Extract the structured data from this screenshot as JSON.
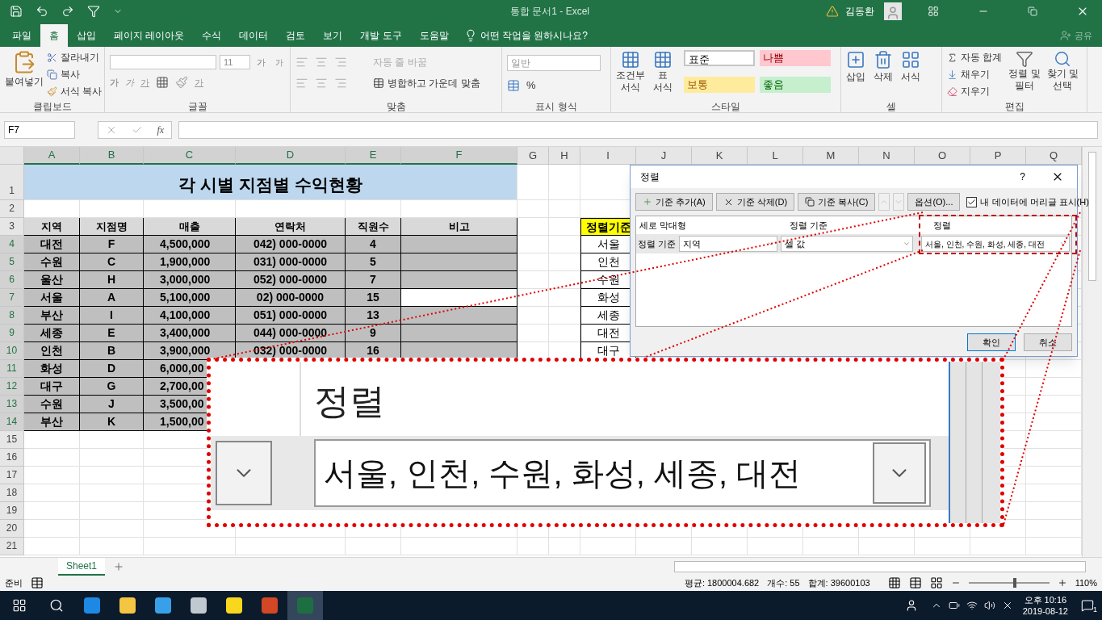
{
  "title_bar": {
    "title": "통합 문서1  -  Excel",
    "user": "김동환"
  },
  "tabs": [
    {
      "label": "파일",
      "selected": false
    },
    {
      "label": "홈",
      "selected": true
    },
    {
      "label": "삽입",
      "selected": false
    },
    {
      "label": "페이지 레이아웃",
      "selected": false
    },
    {
      "label": "수식",
      "selected": false
    },
    {
      "label": "데이터",
      "selected": false
    },
    {
      "label": "검토",
      "selected": false
    },
    {
      "label": "보기",
      "selected": false
    },
    {
      "label": "개발 도구",
      "selected": false
    },
    {
      "label": "도움말",
      "selected": false
    }
  ],
  "tell_me": "어떤 작업을 원하시나요?",
  "share": "공유",
  "clipboard": {
    "label": "클립보드",
    "paste": "붙여넣기",
    "cut": "잘라내기",
    "copy": "복사",
    "format_painter": "서식 복사"
  },
  "font": {
    "label": "글꼴",
    "size": "11",
    "grow": "가",
    "shrink": "가",
    "bold": "가",
    "italic": "가",
    "underline": "가",
    "font_color": "가"
  },
  "alignment": {
    "label": "맞춤",
    "wrap_text": {
      "label": "자동 줄 바꿈",
      "disabled": true
    },
    "merge": "병합하고 가운데 맞춤"
  },
  "number": {
    "label": "표시 형식",
    "format": "일반",
    "percent": "%"
  },
  "styles": {
    "label": "스타일",
    "conditional": [
      "조건부",
      "서식"
    ],
    "table": [
      "표",
      "서식"
    ],
    "cell_styles": [
      {
        "label": "표준",
        "color": "#ffffff"
      },
      {
        "label": "나쁨",
        "color": "#ffc7ce"
      },
      {
        "label": "보통",
        "color": "#ffeb9c"
      },
      {
        "label": "좋음",
        "color": "#c6efce"
      }
    ]
  },
  "cells": {
    "label": "셀",
    "buttons": [
      "삽입",
      "삭제",
      "서식"
    ]
  },
  "editing": {
    "label": "편집",
    "autosum": "자동 합계",
    "fill": "채우기",
    "clear": "지우기",
    "sort_filter": [
      "정렬 및",
      "필터"
    ],
    "find_select": [
      "찾기 및",
      "선택"
    ]
  },
  "formula_bar": {
    "name_box": "F7",
    "function_button": "fx"
  },
  "sheet": {
    "columns": [
      {
        "label": "A",
        "selected": true
      },
      {
        "label": "B",
        "selected": true
      },
      {
        "label": "C",
        "selected": true
      },
      {
        "label": "D",
        "selected": true
      },
      {
        "label": "E",
        "selected": true
      },
      {
        "label": "F",
        "selected": true
      },
      {
        "label": "G",
        "selected": false
      },
      {
        "label": "H",
        "selected": false
      },
      {
        "label": "I",
        "selected": false
      },
      {
        "label": "J",
        "selected": false
      },
      {
        "label": "K",
        "selected": false
      },
      {
        "label": "L",
        "selected": false
      },
      {
        "label": "M",
        "selected": false
      },
      {
        "label": "N",
        "selected": false
      },
      {
        "label": "O",
        "selected": false
      },
      {
        "label": "P",
        "selected": false
      },
      {
        "label": "Q",
        "selected": false
      }
    ],
    "rows": [
      {
        "label": "1",
        "selected": false
      },
      {
        "label": "2",
        "selected": false
      },
      {
        "label": "3",
        "selected": false
      },
      {
        "label": "4",
        "selected": true
      },
      {
        "label": "5",
        "selected": true
      },
      {
        "label": "6",
        "selected": true
      },
      {
        "label": "7",
        "selected": true
      },
      {
        "label": "8",
        "selected": true
      },
      {
        "label": "9",
        "selected": true
      },
      {
        "label": "10",
        "selected": true
      },
      {
        "label": "11",
        "selected": true
      },
      {
        "label": "12",
        "selected": true
      },
      {
        "label": "13",
        "selected": true
      },
      {
        "label": "14",
        "selected": true
      },
      {
        "label": "15",
        "selected": false
      },
      {
        "label": "16",
        "selected": false
      },
      {
        "label": "17",
        "selected": false
      },
      {
        "label": "18",
        "selected": false
      },
      {
        "label": "19",
        "selected": false
      },
      {
        "label": "20",
        "selected": false
      },
      {
        "label": "21",
        "selected": false
      }
    ],
    "title": "각 시별 지점별 수익현황",
    "headers": [
      "지역",
      "지점명",
      "매출",
      "연락처",
      "직원수",
      "비고"
    ],
    "records": [
      {
        "cells": [
          "대전",
          "F",
          "4,500,000",
          "042) 000-0000",
          "4"
        ],
        "active": false
      },
      {
        "cells": [
          "수원",
          "C",
          "1,900,000",
          "031) 000-0000",
          "5"
        ],
        "active": false
      },
      {
        "cells": [
          "울산",
          "H",
          "3,000,000",
          "052) 000-0000",
          "7"
        ],
        "active": false
      },
      {
        "cells": [
          "서울",
          "A",
          "5,100,000",
          "02) 000-0000",
          "15"
        ],
        "active": true
      },
      {
        "cells": [
          "부산",
          "I",
          "4,100,000",
          "051) 000-0000",
          "13"
        ],
        "active": false
      },
      {
        "cells": [
          "세종",
          "E",
          "3,400,000",
          "044) 000-0000",
          "9"
        ],
        "active": false
      },
      {
        "cells": [
          "인천",
          "B",
          "3,900,000",
          "032) 000-0000",
          "16"
        ],
        "active": false
      },
      {
        "cells": [
          "화성",
          "D",
          "6,000,00"
        ]
      },
      {
        "cells": [
          "대구",
          "G",
          "2,700,00"
        ]
      },
      {
        "cells": [
          "수원",
          "J",
          "3,500,00"
        ]
      },
      {
        "cells": [
          "부산",
          "K",
          "1,500,00"
        ]
      }
    ],
    "criteria": {
      "header": "정렬기준",
      "items": [
        "서울",
        "인천",
        "수원",
        "화성",
        "세종",
        "대전",
        "대구"
      ]
    }
  },
  "dialog": {
    "title": "정렬",
    "help": "?",
    "add": "기준 추가(A)",
    "delete": "기준 삭제(D)",
    "copy": "기준 복사(C)",
    "options": "옵션(O)...",
    "header_checkbox": {
      "label": "내 데이터에 머리글 표시(H)",
      "checked": true
    },
    "columns": [
      "세로 막대형",
      "정렬 기준",
      "정렬"
    ],
    "row_label": "정렬 기준",
    "column_value": "지역",
    "sort_on": "셀 값",
    "order": "서울, 인천, 수원, 화성, 세종, 대전",
    "ok": "확인",
    "cancel": "취소"
  },
  "callout": {
    "heading": "정렬",
    "value": "서울, 인천, 수원, 화성, 세종, 대전"
  },
  "sheet_tab": {
    "label": "Sheet1",
    "selected": true
  },
  "status_bar": {
    "mode": "준비",
    "average": "평균: 1800004.682",
    "count": "개수: 55",
    "sum": "합계: 39600103",
    "zoom": "110%",
    "zoom_slider": {
      "level": 0.55
    }
  },
  "taskbar": {
    "time": "오후 10:16",
    "date": "2019-08-12",
    "notifications": "1"
  }
}
